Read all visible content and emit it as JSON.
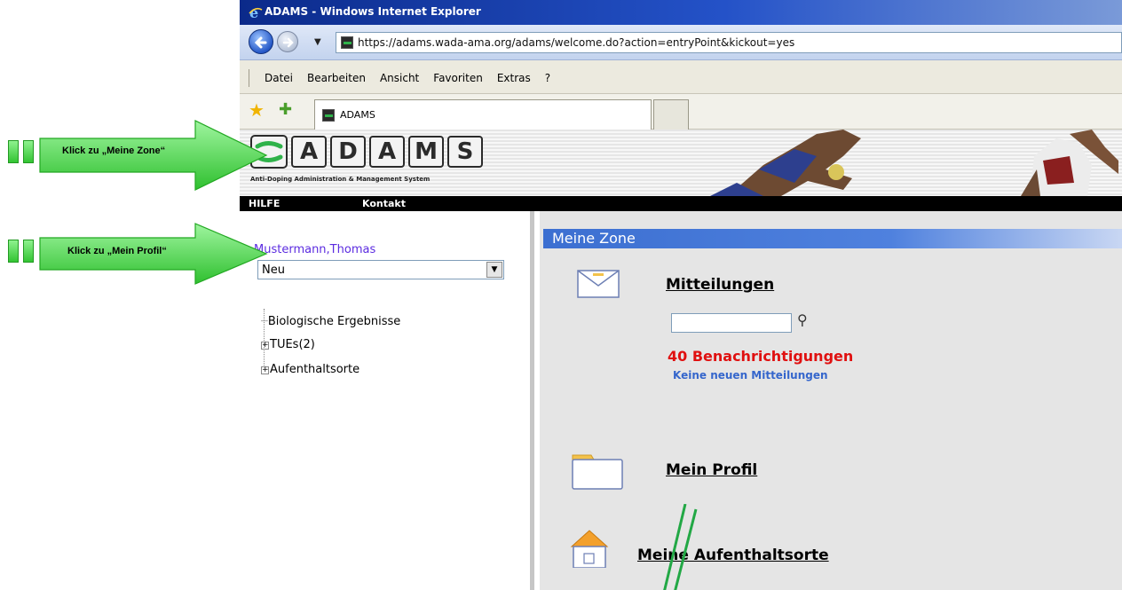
{
  "browser": {
    "window_title": "ADAMS - Windows Internet Explorer",
    "url": "https://adams.wada-ama.org/adams/welcome.do?action=entryPoint&kickout=yes",
    "menu": [
      "Datei",
      "Bearbeiten",
      "Ansicht",
      "Favoriten",
      "Extras",
      "?"
    ],
    "tab_title": "ADAMS"
  },
  "site": {
    "logo_letters": [
      "A",
      "D",
      "A",
      "M",
      "S"
    ],
    "tagline": "Anti-Doping Administration & Management System",
    "nav": {
      "help": "HILFE",
      "contact": "Kontakt"
    }
  },
  "sidebar": {
    "user_name": "Mustermann,Thomas",
    "role_select_value": "Neu",
    "tree": [
      {
        "label": "Biologische Ergebnisse",
        "expandable": false
      },
      {
        "label": "TUEs(2)",
        "expandable": true
      },
      {
        "label": "Aufenthaltsorte",
        "expandable": true
      }
    ]
  },
  "main": {
    "header": "Meine Zone",
    "messages": {
      "title": "Mitteilungen",
      "search_value": "",
      "notifications": "40 Benachrichtigungen",
      "no_new": "Keine neuen Mitteilungen"
    },
    "profile": {
      "title": "Mein Profil"
    },
    "whereabouts": {
      "title": "Meine Aufenthaltsorte"
    }
  },
  "callouts": {
    "zone": "Klick zu  „Meine Zone“",
    "profile": "Klick zu „Mein Profil“"
  },
  "colors": {
    "title_bar": "#0b2a8a",
    "header_blue": "#3c6fd1",
    "notification_red": "#e01010",
    "link_blue": "#3566cc",
    "username_purple": "#5b2be0",
    "callout_green": "#33c433"
  }
}
